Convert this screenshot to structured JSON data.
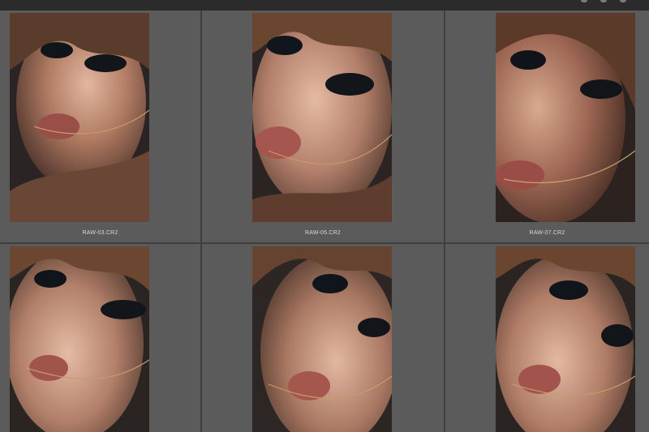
{
  "filmstrip": {
    "cells": [
      {
        "filename": "RAW-03.CR2",
        "photo_label": "portrait-wet-hair-1"
      },
      {
        "filename": "RAW-05.CR2",
        "photo_label": "portrait-wet-hair-2"
      },
      {
        "filename": "RAW-07.CR2",
        "photo_label": "portrait-wet-hair-3"
      },
      {
        "filename": "",
        "photo_label": "portrait-wet-hair-4"
      },
      {
        "filename": "",
        "photo_label": "portrait-wet-hair-5"
      },
      {
        "filename": "",
        "photo_label": "portrait-wet-hair-6"
      }
    ]
  },
  "colors": {
    "cell_bg": "#5b5b5b",
    "grid_bg": "#3f3f3f",
    "caption": "#d8d8d8"
  }
}
